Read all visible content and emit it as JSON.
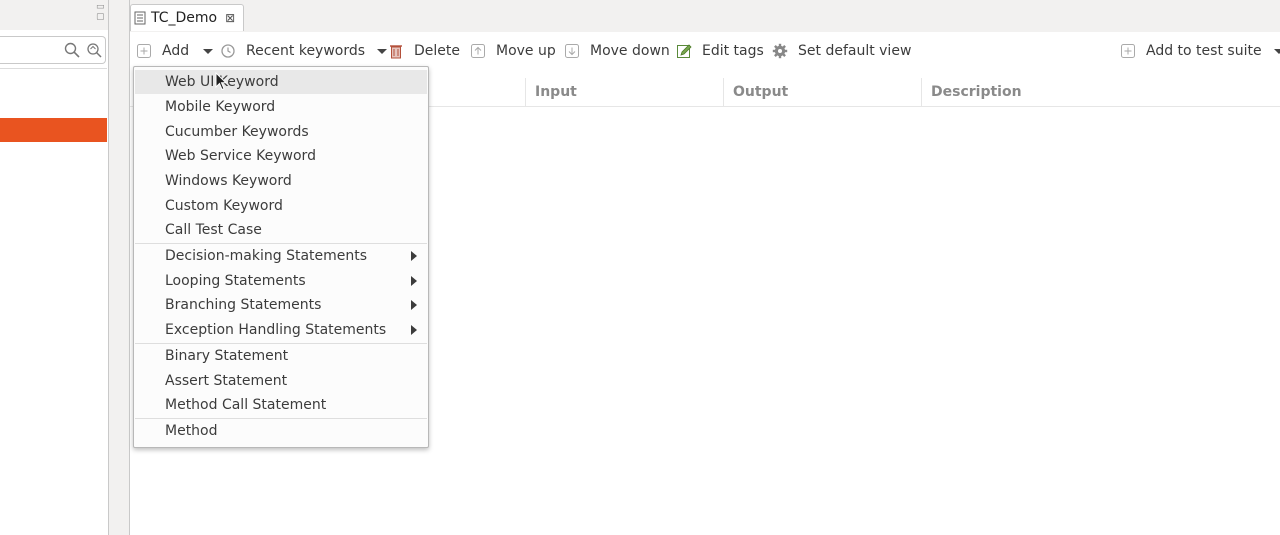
{
  "tab": {
    "title": "TC_Demo",
    "close": "⊠"
  },
  "toolbar": {
    "add": "Add",
    "recent_keywords": "Recent keywords",
    "delete": "Delete",
    "move_up": "Move up",
    "move_down": "Move down",
    "edit_tags": "Edit tags",
    "set_default_view": "Set default view",
    "add_to_test_suite": "Add to test suite"
  },
  "table": {
    "columns": [
      "Input",
      "Output",
      "Description"
    ]
  },
  "menu": {
    "group1": [
      "Web UI Keyword",
      "Mobile Keyword",
      "Cucumber Keywords",
      "Web Service Keyword",
      "Windows Keyword",
      "Custom Keyword",
      "Call Test Case"
    ],
    "group2": [
      "Decision-making Statements",
      "Looping Statements",
      "Branching Statements",
      "Exception Handling Statements"
    ],
    "group3": [
      "Binary Statement",
      "Assert Statement",
      "Method Call Statement"
    ],
    "group4": [
      "Method"
    ]
  },
  "colors": {
    "accent": "#e95420",
    "menu_hover": "#e8e8e8",
    "header_text": "#8a8a8a"
  }
}
